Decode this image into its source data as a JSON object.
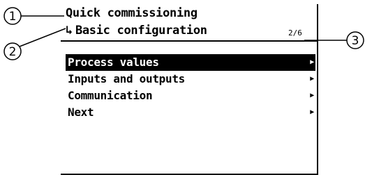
{
  "callouts": [
    {
      "number": "1",
      "target": "title"
    },
    {
      "number": "2",
      "target": "subtitle"
    },
    {
      "number": "3",
      "target": "page-indicator"
    }
  ],
  "screen": {
    "title": "Quick commissioning",
    "subtitle_arrow": "↳",
    "subtitle": "Basic configuration",
    "page_indicator": "2/6",
    "menu": [
      {
        "label": "Process values",
        "selected": true,
        "arrow": "▶"
      },
      {
        "label": "Inputs and outputs",
        "selected": false,
        "arrow": "▶"
      },
      {
        "label": "Communication",
        "selected": false,
        "arrow": "▶"
      },
      {
        "label": "Next",
        "selected": false,
        "arrow": "▶"
      }
    ]
  },
  "colors": {
    "foreground": "#000000",
    "background": "#ffffff",
    "selection_background": "#000000",
    "selection_text": "#ffffff"
  }
}
